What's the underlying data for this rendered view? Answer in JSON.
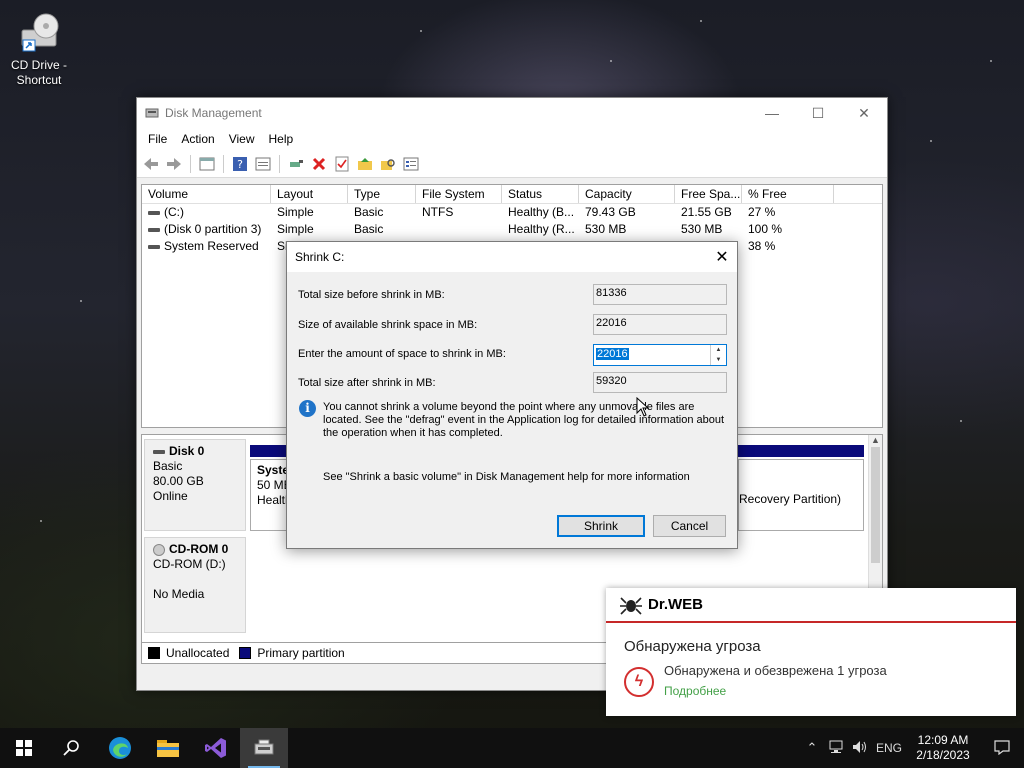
{
  "desktop": {
    "icon_label": "CD Drive - Shortcut"
  },
  "window": {
    "title": "Disk Management",
    "menu": [
      "File",
      "Action",
      "View",
      "Help"
    ],
    "columns": [
      "Volume",
      "Layout",
      "Type",
      "File System",
      "Status",
      "Capacity",
      "Free Spa...",
      "% Free"
    ],
    "rows": [
      {
        "volume": "(C:)",
        "layout": "Simple",
        "type": "Basic",
        "fs": "NTFS",
        "status": "Healthy (B...",
        "capacity": "79.43 GB",
        "free": "21.55 GB",
        "pct": "27 %"
      },
      {
        "volume": "(Disk 0 partition 3)",
        "layout": "Simple",
        "type": "Basic",
        "fs": "",
        "status": "Healthy (R...",
        "capacity": "530 MB",
        "free": "530 MB",
        "pct": "100 %"
      },
      {
        "volume": "System Reserved",
        "layout": "Si",
        "type": "",
        "fs": "",
        "status": "",
        "capacity": "",
        "free": "",
        "pct": "38 %"
      }
    ],
    "disk0": {
      "name": "Disk 0",
      "type": "Basic",
      "size": "80.00 GB",
      "state": "Online"
    },
    "partition_sys": {
      "name": "Syster",
      "size": "50 MB",
      "status": "Health"
    },
    "partition_recovery": "Recovery Partition)",
    "cdrom": {
      "name": "CD-ROM 0",
      "drive": "CD-ROM (D:)",
      "media": "No Media"
    },
    "legend": {
      "unallocated": "Unallocated",
      "primary": "Primary partition"
    }
  },
  "dialog": {
    "title": "Shrink C:",
    "total_before_label": "Total size before shrink in MB:",
    "total_before_value": "81336",
    "available_label": "Size of available shrink space in MB:",
    "available_value": "22016",
    "enter_label": "Enter the amount of space to shrink in MB:",
    "enter_value": "22016",
    "after_label": "Total size after shrink in MB:",
    "after_value": "59320",
    "info": "You cannot shrink a volume beyond the point where any unmovable files are located. See the \"defrag\" event in the Application log for detailed information about the operation when it has completed.",
    "help": "See \"Shrink a basic volume\" in Disk Management help for more information",
    "shrink_button": "Shrink",
    "cancel_button": "Cancel"
  },
  "drweb": {
    "brand": "Dr.WEB",
    "heading": "Обнаружена угроза",
    "message": "Обнаружена и обезврежена 1 угроза",
    "link": "Подробнее"
  },
  "taskbar": {
    "language": "ENG",
    "time": "12:09 AM",
    "date": "2/18/2023"
  },
  "colors": {
    "accent": "#0078d7",
    "primary_partition": "#0a0a7a",
    "drweb_red": "#c62828",
    "drweb_link": "#43a047"
  }
}
